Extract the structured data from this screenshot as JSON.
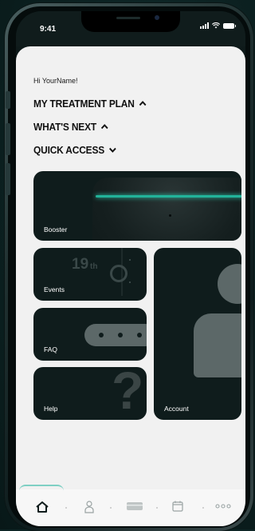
{
  "status_bar": {
    "time": "9:41"
  },
  "greeting": "Hi YourName!",
  "sections": {
    "treatment_plan": "MY TREATMENT PLAN",
    "whats_next": "WHAT'S NEXT",
    "quick_access": "QUICK ACCESS"
  },
  "tiles": {
    "booster": "Booster",
    "events": "Events",
    "events_day": "19",
    "events_suffix": "th",
    "faq": "FAQ",
    "help": "Help",
    "help_glyph": "?",
    "account": "Account"
  },
  "bottom_nav": {
    "items": [
      {
        "icon": "home-icon",
        "active": true
      },
      {
        "icon": "person-icon",
        "active": false
      },
      {
        "icon": "device-icon",
        "active": false
      },
      {
        "icon": "calendar-icon",
        "active": false
      },
      {
        "icon": "more-icon",
        "active": false
      }
    ]
  },
  "colors": {
    "accent": "#22b39a",
    "tile_bg": "#0f1c1c",
    "screen_bg": "#f1f1f1"
  }
}
